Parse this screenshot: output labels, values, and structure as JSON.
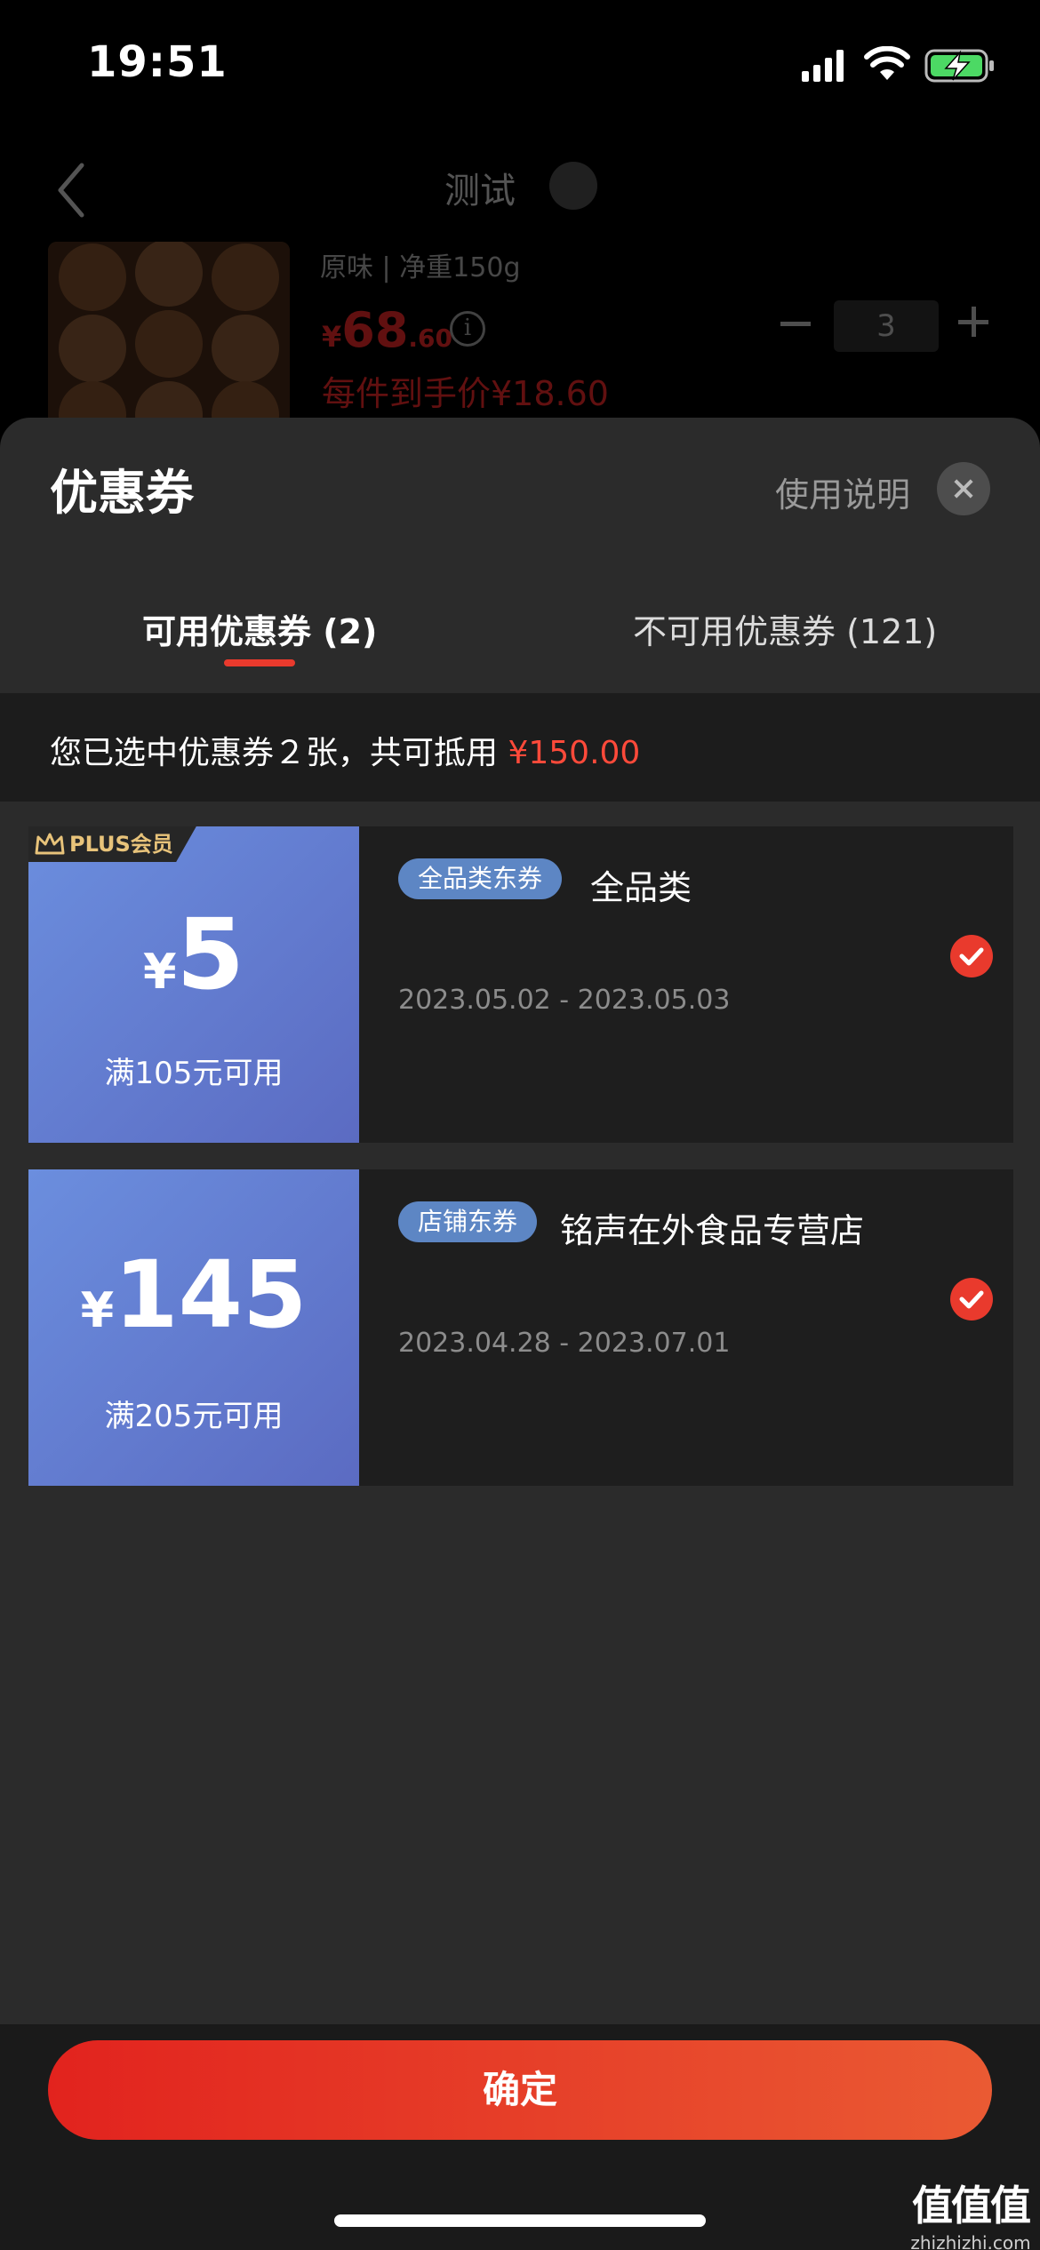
{
  "status_bar": {
    "time": "19:51"
  },
  "background_page": {
    "store_name": "测试",
    "spec": "原味 | 净重150g",
    "price_symbol": "¥",
    "price_int": "68",
    "price_dec": ".60",
    "unit_price": "每件到手价¥18.60",
    "quantity": "3"
  },
  "sheet": {
    "title": "优惠券",
    "help_label": "使用说明",
    "tabs": [
      {
        "label": "可用优惠券 (2)",
        "active": true
      },
      {
        "label": "不可用优惠券 (121)",
        "active": false
      }
    ],
    "summary": {
      "text": "您已选中优惠券２张，共可抵用 ",
      "amount": "¥150.00"
    }
  },
  "coupons": [
    {
      "badge": "PLUS会员",
      "currency": "¥",
      "amount": "5",
      "threshold": "满105元可用",
      "tag": "全品类东券",
      "name": "全品类",
      "date": "2023.05.02 - 2023.05.03",
      "selected": true
    },
    {
      "currency": "¥",
      "amount": "145",
      "threshold": "满205元可用",
      "tag": "店铺东券",
      "name": "铭声在外食品专营店",
      "date": "2023.04.28 - 2023.07.01",
      "selected": true
    }
  ],
  "footer": {
    "confirm_label": "确定",
    "watermark_main": "值值值",
    "watermark_sub": "zhizhizhi.com"
  },
  "colors": {
    "accent_red": "#e93a2d",
    "coupon_gradient_start": "#6b8ede",
    "coupon_gradient_end": "#5b6bc2",
    "tag_blue": "#5d86c4"
  }
}
